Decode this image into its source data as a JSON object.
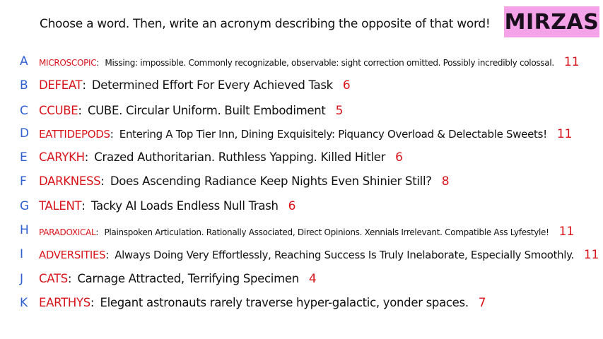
{
  "header": {
    "prompt": "Choose a word. Then, write an acronym describing the opposite of that word!",
    "badge": "MIRZAS"
  },
  "rows": [
    {
      "letter": "A",
      "word": "MICROSCOPIC",
      "desc": "Missing: impossible. Commonly recognizable, observable: sight correction omitted. Possibly incredibly colossal.",
      "count": "11"
    },
    {
      "letter": "B",
      "word": "DEFEAT",
      "desc": "Determined Effort For Every Achieved Task",
      "count": "6"
    },
    {
      "letter": "C",
      "word": "CCUBE",
      "desc": "CUBE. Circular Uniform. Built Embodiment",
      "count": "5"
    },
    {
      "letter": "D",
      "word": "EATTIDEPODS",
      "desc": "Entering A Top Tier Inn, Dining Exquisitely: Piquancy Overload & Delectable Sweets!",
      "count": "11"
    },
    {
      "letter": "E",
      "word": "CARYKH",
      "desc": "Crazed Authoritarian. Ruthless Yapping. Killed Hitler",
      "count": "6"
    },
    {
      "letter": "F",
      "word": "DARKNESS",
      "desc": "Does Ascending Radiance Keep Nights Even Shinier Still?",
      "count": "8"
    },
    {
      "letter": "G",
      "word": "TALENT",
      "desc": "Tacky AI Loads Endless Null Trash",
      "count": "6"
    },
    {
      "letter": "H",
      "word": "PARADOXICAL",
      "desc": "Plainspoken Articulation. Rationally Associated, Direct Opinions. Xennials Irrelevant. Compatible Ass Lyfestyle!",
      "count": "11"
    },
    {
      "letter": "I",
      "word": "ADVERSITIES",
      "desc": "Always Doing Very Effortlessly, Reaching Success Is Truly Inelaborate, Especially Smoothly.",
      "count": "11"
    },
    {
      "letter": "J",
      "word": "CATS",
      "desc": "Carnage Attracted, Terrifying Specimen",
      "count": "4"
    },
    {
      "letter": "K",
      "word": "EARTHYS",
      "desc": "Elegant astronauts rarely traverse hyper-galactic, yonder spaces.",
      "count": "7"
    }
  ],
  "colors": {
    "letter": "#2f5fd0",
    "word": "#d8141b",
    "badge": "#f4a3e9"
  }
}
